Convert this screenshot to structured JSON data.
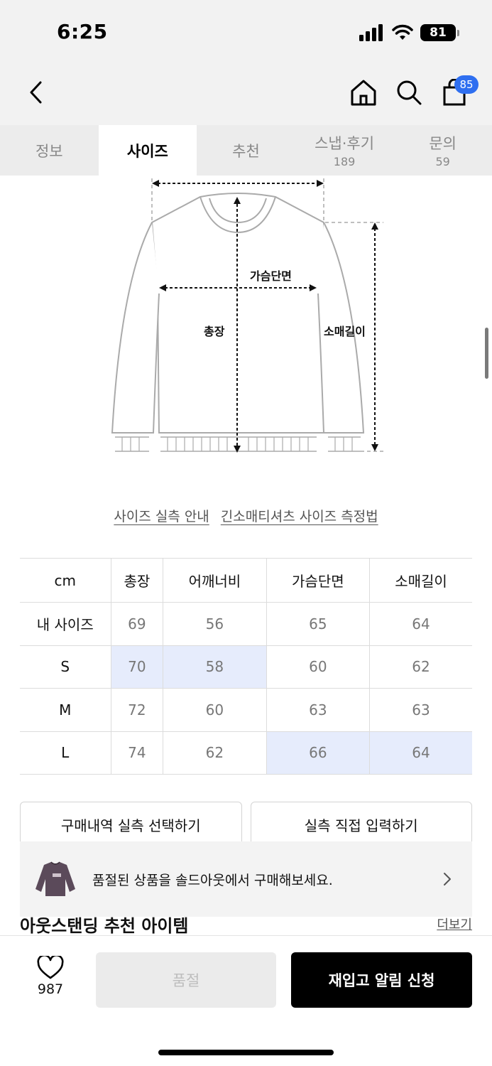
{
  "status": {
    "time": "6:25",
    "battery": "81"
  },
  "header": {
    "cart_badge": "85"
  },
  "tabs": [
    {
      "label": "정보",
      "count": ""
    },
    {
      "label": "사이즈",
      "count": ""
    },
    {
      "label": "추천",
      "count": ""
    },
    {
      "label": "스냅·후기",
      "count": "189"
    },
    {
      "label": "문의",
      "count": "59"
    }
  ],
  "active_tab": "사이즈",
  "diagram": {
    "chest": "가슴단면",
    "length": "총장",
    "sleeve": "소매길이"
  },
  "links": {
    "measure_guide": "사이즈 실측 안내",
    "how_to_measure": "긴소매티셔츠 사이즈 측정법"
  },
  "size_table": {
    "columns": [
      "cm",
      "총장",
      "어깨너비",
      "가슴단면",
      "소매길이"
    ],
    "rows": [
      {
        "label": "내 사이즈",
        "values": [
          "69",
          "56",
          "65",
          "64"
        ]
      },
      {
        "label": "S",
        "values": [
          "70",
          "58",
          "60",
          "62"
        ]
      },
      {
        "label": "M",
        "values": [
          "72",
          "60",
          "63",
          "63"
        ]
      },
      {
        "label": "L",
        "values": [
          "74",
          "62",
          "66",
          "64"
        ]
      }
    ]
  },
  "actions": {
    "select_purchase": "구매내역 실측 선택하기",
    "direct_input": "실측 직접 입력하기"
  },
  "sold_banner": {
    "message": "품절된 상품을 솔드아웃에서 구매해보세요."
  },
  "recommend": {
    "heading": "아웃스탠딩 추천 아이템",
    "more": "더보기"
  },
  "bottom": {
    "likes": "987",
    "soldout": "품절",
    "restock": "재입고 알림 신청"
  },
  "colors": {
    "highlight": "#e6ecfc",
    "badge": "#2f6ff0",
    "primary": "#000000"
  }
}
